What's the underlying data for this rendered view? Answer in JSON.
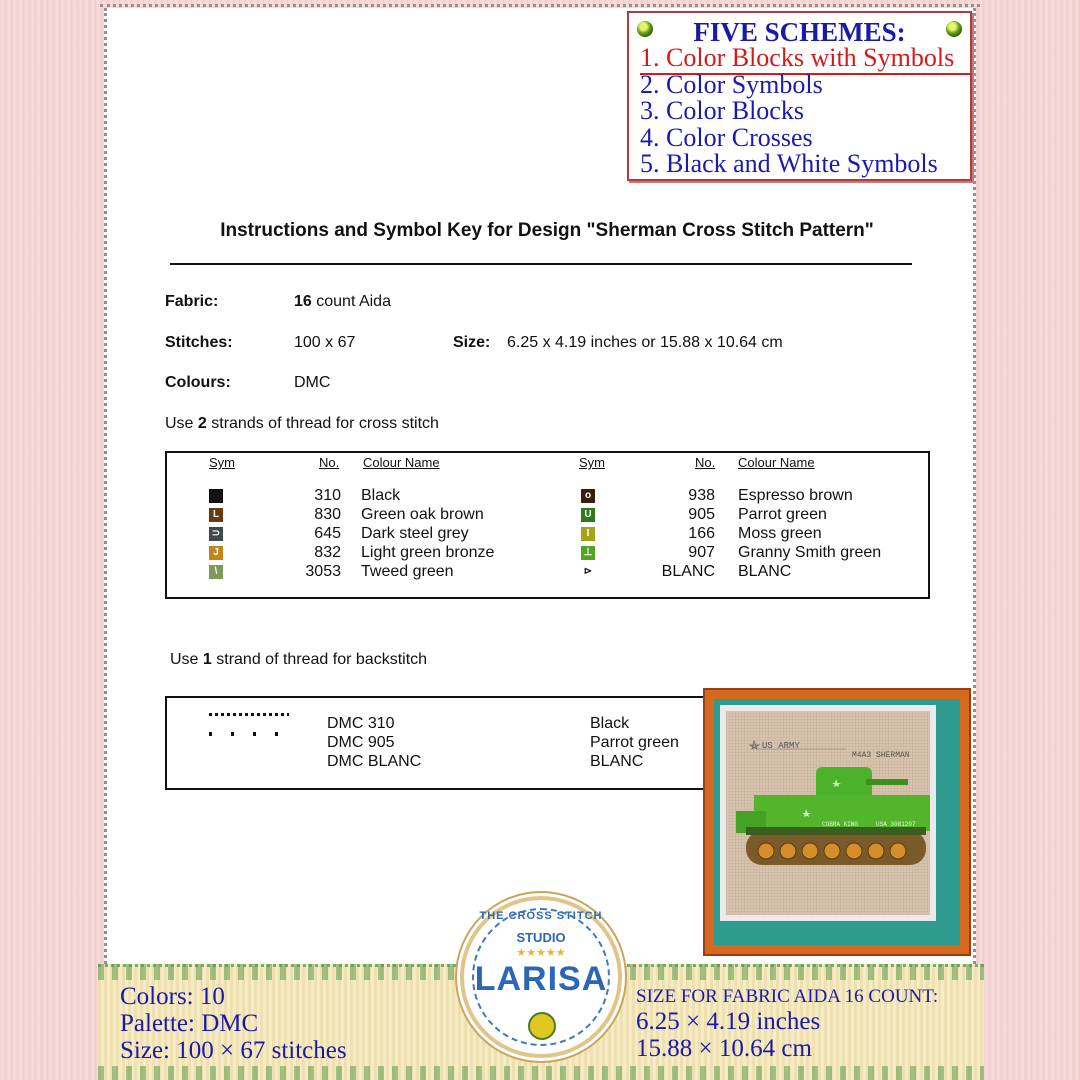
{
  "schemes": {
    "title": "FIVE SCHEMES:",
    "items": [
      "1. Color Blocks with Symbols",
      "2. Color Symbols",
      "3. Color Blocks",
      "4. Color Crosses",
      "5. Black and White Symbols"
    ],
    "active_index": 0
  },
  "doc": {
    "title": "Instructions and Symbol Key for Design \"Sherman Cross Stitch Pattern\"",
    "fabric_label": "Fabric:",
    "fabric_count": "16",
    "fabric_value": " count Aida",
    "stitches_label": "Stitches:",
    "stitches_value": "100 x 67",
    "size_label": "Size:",
    "size_value": "6.25 x 4.19 inches or 15.88 x 10.64 cm",
    "colours_label": "Colours:",
    "colours_value": "DMC",
    "cross_prefix": "Use ",
    "cross_strands": "2",
    "cross_suffix": " strands of thread for cross stitch",
    "back_prefix": "Use ",
    "back_strands": "1",
    "back_suffix": " strand of thread for backstitch"
  },
  "key": {
    "headers": {
      "sym": "Sym",
      "no": "No.",
      "name": "Colour Name"
    },
    "left": [
      {
        "symbol": "",
        "color": "#111111",
        "no": "310",
        "name": "Black"
      },
      {
        "symbol": "L",
        "color": "#6b3a10",
        "no": "830",
        "name": "Green oak brown"
      },
      {
        "symbol": "⊃",
        "color": "#3f4a4a",
        "no": "645",
        "name": "Dark steel grey"
      },
      {
        "symbol": "J",
        "color": "#c3861c",
        "no": "832",
        "name": "Light green bronze"
      },
      {
        "symbol": "\\",
        "color": "#7f9a55",
        "no": "3053",
        "name": "Tweed green"
      }
    ],
    "right": [
      {
        "symbol": "o",
        "color": "#3b1d10",
        "no": "938",
        "name": "Espresso brown"
      },
      {
        "symbol": "U",
        "color": "#2e7a1a",
        "no": "905",
        "name": "Parrot green"
      },
      {
        "symbol": "I",
        "color": "#a7a21a",
        "no": "166",
        "name": "Moss green"
      },
      {
        "symbol": "⊥",
        "color": "#52a51f",
        "no": "907",
        "name": "Granny Smith green"
      },
      {
        "symbol": "⊳",
        "color": "#ffffff",
        "no": "BLANC",
        "name": "BLANC"
      }
    ]
  },
  "backstitch": [
    {
      "code": "DMC 310",
      "name": "Black"
    },
    {
      "code": "DMC 905",
      "name": "Parrot green"
    },
    {
      "code": "DMC  BLANC",
      "name": "BLANC"
    }
  ],
  "preview": {
    "label_army": "US ARMY",
    "label_model": "M4A3 SHERMAN",
    "label_side_1": "COBRA KING",
    "label_side_2": "USA 3081207"
  },
  "stats": {
    "colors": "Colors: 10",
    "palette": "Palette: DMC",
    "size": "Size: 100 × 67 stitches",
    "fabric_heading": "SIZE FOR FABRIC AIDA 16 COUNT:",
    "inches": "6.25 × 4.19 inches",
    "cm": "15.88 × 10.64 cm"
  },
  "logo": {
    "brand": "THE CROSS STITCH",
    "studio": "STUDIO",
    "stars": "★★★★★",
    "name": "LARISA"
  }
}
